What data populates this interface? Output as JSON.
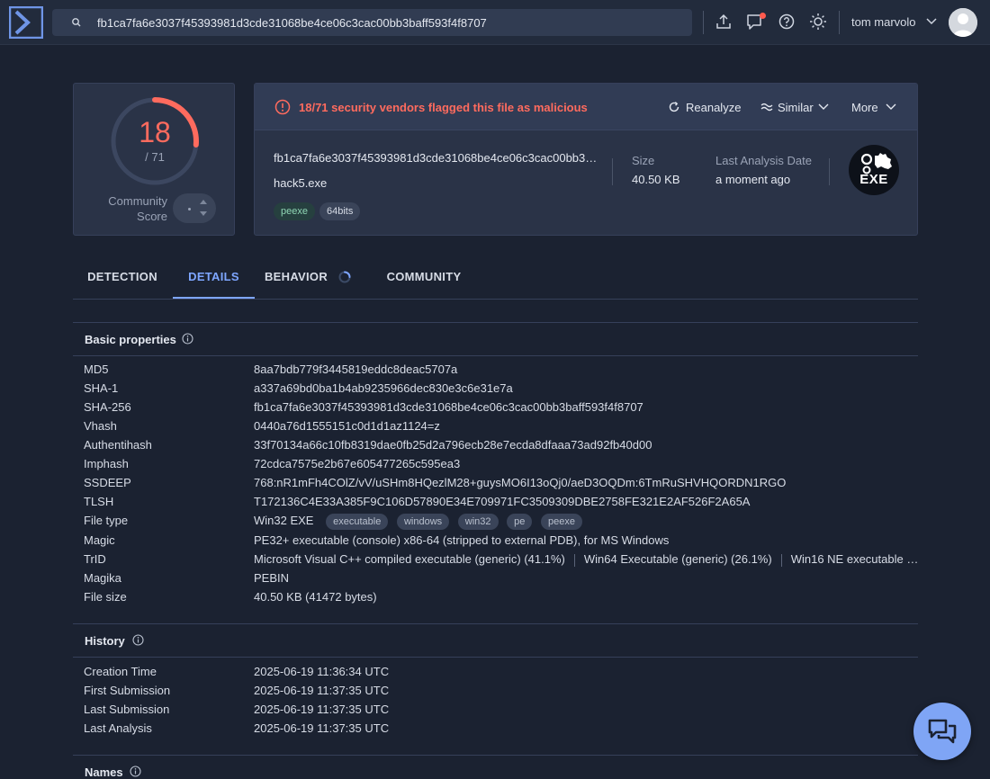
{
  "search": {
    "value": "fb1ca7fa6e3037f45393981d3cde31068be4ce06c3cac00bb3baff593f4f8707"
  },
  "user": {
    "name": "tom marvolo"
  },
  "score": {
    "detected": "18",
    "total": "/ 71",
    "community_label_1": "Community",
    "community_label_2": "Score"
  },
  "alert": {
    "text": "18/71 security vendors flagged this file as malicious"
  },
  "actions": {
    "reanalyze": "Reanalyze",
    "similar": "Similar",
    "more": "More"
  },
  "file": {
    "hash": "fb1ca7fa6e3037f45393981d3cde31068be4ce06c3cac00bb3baff593f4f8707",
    "name": "hack5.exe",
    "tags": [
      "peexe",
      "64bits"
    ],
    "size_label": "Size",
    "size_value": "40.50 KB",
    "date_label": "Last Analysis Date",
    "date_value": "a moment ago",
    "badge": "EXE"
  },
  "tabs": [
    "DETECTION",
    "DETAILS",
    "BEHAVIOR",
    "COMMUNITY"
  ],
  "basic": {
    "title": "Basic properties",
    "rows": [
      {
        "k": "MD5",
        "v": "8aa7bdb779f3445819eddc8deac5707a"
      },
      {
        "k": "SHA-1",
        "v": "a337a69bd0ba1b4ab9235966dec830e3c6e31e7a"
      },
      {
        "k": "SHA-256",
        "v": "fb1ca7fa6e3037f45393981d3cde31068be4ce06c3cac00bb3baff593f4f8707"
      },
      {
        "k": "Vhash",
        "v": "0440a76d1555151c0d1d1az1124=z"
      },
      {
        "k": "Authentihash",
        "v": "33f70134a66c10fb8319dae0fb25d2a796ecb28e7ecda8dfaaa73ad92fb40d00"
      },
      {
        "k": "Imphash",
        "v": "72cdca7575e2b67e605477265c595ea3"
      },
      {
        "k": "SSDEEP",
        "v": "768:nR1mFh4COlZ/vV/uSHm8HQezlM28+guysMO6I13oQj0/aeD3OQDm:6TmRuSHVHQORDN1RGO"
      },
      {
        "k": "TLSH",
        "v": "T172136C4E33A385F9C106D57890E34E709971FC3509309DBE2758FE321E2AF526F2A65A"
      },
      {
        "k": "File type",
        "v": "Win32 EXE"
      },
      {
        "k": "Magic",
        "v": "PE32+ executable (console) x86-64 (stripped to external PDB), for MS Windows"
      },
      {
        "k": "TrID",
        "v": ""
      },
      {
        "k": "Magika",
        "v": "PEBIN"
      },
      {
        "k": "File size",
        "v": "40.50 KB (41472 bytes)"
      }
    ],
    "filetype_tags": [
      "executable",
      "windows",
      "win32",
      "pe",
      "peexe"
    ],
    "trid": [
      "Microsoft Visual C++ compiled executable (generic) (41.1%)",
      "Win64 Executable (generic) (26.1%)",
      "Win16 NE executable …"
    ]
  },
  "history": {
    "title": "History",
    "rows": [
      {
        "k": "Creation Time",
        "v": "2025-06-19 11:36:34 UTC"
      },
      {
        "k": "First Submission",
        "v": "2025-06-19 11:37:35 UTC"
      },
      {
        "k": "Last Submission",
        "v": "2025-06-19 11:37:35 UTC"
      },
      {
        "k": "Last Analysis",
        "v": "2025-06-19 11:37:35 UTC"
      }
    ]
  },
  "names": {
    "title": "Names"
  },
  "colors": {
    "accent": "#7ea6ff",
    "danger": "#ff6b5e",
    "background": "#1b2231",
    "card": "#2a3347"
  },
  "icons": [
    "logo-icon",
    "search-icon",
    "upload-icon",
    "comment-icon",
    "help-icon",
    "theme-icon",
    "chevron-down-icon",
    "alert-icon",
    "reanalyze-icon",
    "similar-icon",
    "info-icon",
    "chat-icon",
    "spinner-icon"
  ]
}
